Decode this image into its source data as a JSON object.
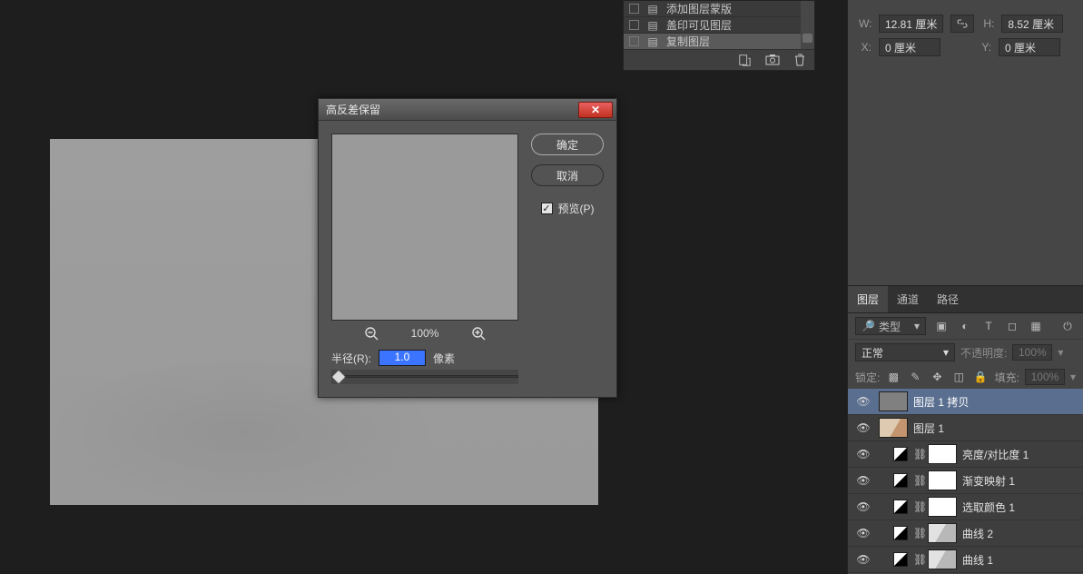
{
  "history": {
    "items": [
      {
        "label": "添加图层蒙版"
      },
      {
        "label": "盖印可见图层"
      },
      {
        "label": "复制图层"
      }
    ]
  },
  "dialog": {
    "title": "高反差保留",
    "ok": "确定",
    "cancel": "取消",
    "preview_label": "预览(P)",
    "zoom_pct": "100%",
    "radius_label": "半径(R):",
    "radius_value": "1.0",
    "radius_unit": "像素"
  },
  "properties": {
    "w_label": "W:",
    "w_value": "12.81 厘米",
    "h_label": "H:",
    "h_value": "8.52 厘米",
    "x_label": "X:",
    "x_value": "0 厘米",
    "y_label": "Y:",
    "y_value": "0 厘米"
  },
  "panels": {
    "tabs": {
      "layers": "图层",
      "channels": "通道",
      "paths": "路径"
    },
    "search_placeholder": "类型",
    "blend_mode": "正常",
    "opacity_label": "不透明度:",
    "opacity_value": "100%",
    "lock_label": "锁定:",
    "fill_label": "填充:",
    "fill_value": "100%"
  },
  "layers": [
    {
      "name": "图层 1 拷贝",
      "type": "grey",
      "selected": true
    },
    {
      "name": "图层 1",
      "type": "img"
    },
    {
      "name": "亮度/对比度 1",
      "type": "adj"
    },
    {
      "name": "渐变映射 1",
      "type": "adj"
    },
    {
      "name": "选取颜色 1",
      "type": "adj"
    },
    {
      "name": "曲线 2",
      "type": "adj_img"
    },
    {
      "name": "曲线 1",
      "type": "adj_img"
    }
  ]
}
